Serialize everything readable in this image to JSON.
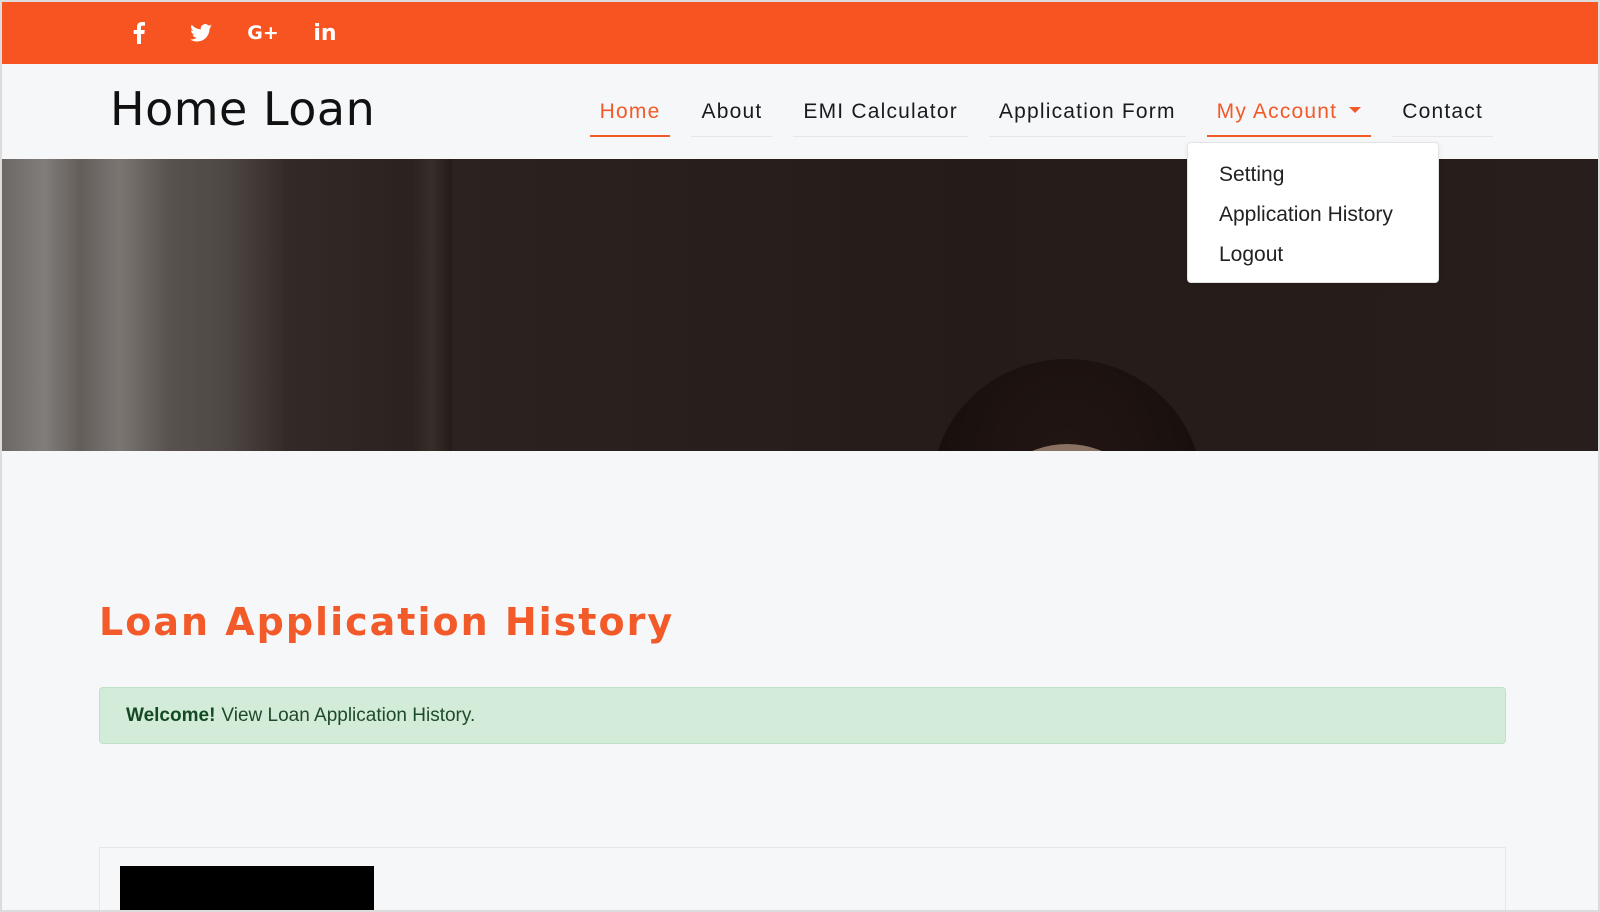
{
  "social": [
    {
      "name": "facebook-icon"
    },
    {
      "name": "twitter-icon"
    },
    {
      "name": "google-plus-icon",
      "label": "G+"
    },
    {
      "name": "linkedin-icon",
      "label": "in"
    }
  ],
  "colors": {
    "accent": "#f75421",
    "link_accent": "#f25a2a",
    "alert_bg": "#d3ecd9",
    "page_bg": "#f6f7f9"
  },
  "header": {
    "brand": "Home Loan"
  },
  "nav": {
    "home": "Home",
    "about": "About",
    "emi": "EMI Calculator",
    "application_form": "Application Form",
    "my_account": "My Account",
    "contact": "Contact"
  },
  "dropdown": {
    "items": [
      "Setting",
      "Application History",
      "Logout"
    ]
  },
  "main": {
    "title": "Loan Application History",
    "alert_strong": "Welcome!",
    "alert_text": "View Loan Application History."
  }
}
